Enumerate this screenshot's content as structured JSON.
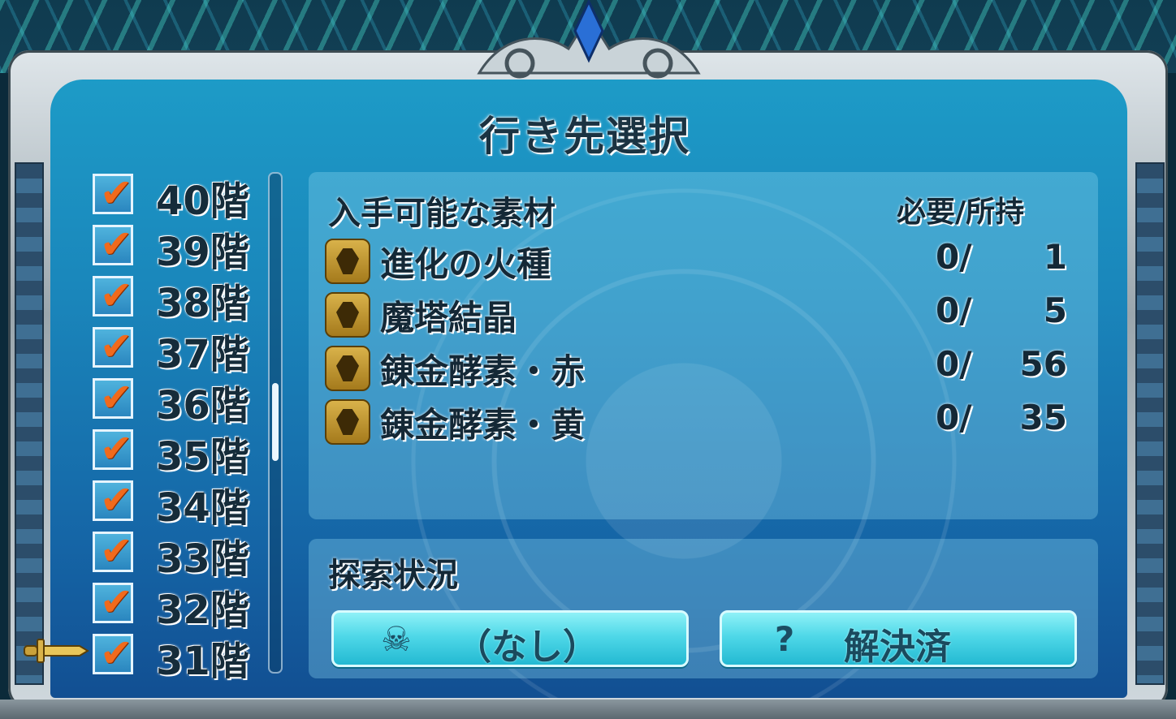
{
  "title": "行き先選択",
  "floors": [
    {
      "label": "40階",
      "checked": true
    },
    {
      "label": "39階",
      "checked": true
    },
    {
      "label": "38階",
      "checked": true
    },
    {
      "label": "37階",
      "checked": true
    },
    {
      "label": "36階",
      "checked": true
    },
    {
      "label": "35階",
      "checked": true
    },
    {
      "label": "34階",
      "checked": true
    },
    {
      "label": "33階",
      "checked": true
    },
    {
      "label": "32階",
      "checked": true
    },
    {
      "label": "31階",
      "checked": true
    }
  ],
  "selected_floor": "31階",
  "check_glyph": "✔",
  "materials": {
    "heading": "入手可能な素材",
    "columns_label": "必要/所持",
    "items": [
      {
        "name": "進化の火種",
        "required": "0/",
        "owned": "1",
        "icon": "crystal-icon"
      },
      {
        "name": "魔塔結晶",
        "required": "0/",
        "owned": "5",
        "icon": "crystal-icon"
      },
      {
        "name": "錬金酵素・赤",
        "required": "0/",
        "owned": "56",
        "icon": "crystal-icon"
      },
      {
        "name": "錬金酵素・黄",
        "required": "0/",
        "owned": "35",
        "icon": "crystal-icon"
      }
    ]
  },
  "status": {
    "heading": "探索状況",
    "buttons": [
      {
        "icon": "monster-icon",
        "glyph": "☠",
        "label": "（なし）"
      },
      {
        "icon": "question-icon",
        "glyph": "?",
        "label": "解決済"
      }
    ]
  },
  "colors": {
    "check": "#f06a1c",
    "button": "#4fd8e8",
    "panel_bg": "#1a86bb"
  }
}
